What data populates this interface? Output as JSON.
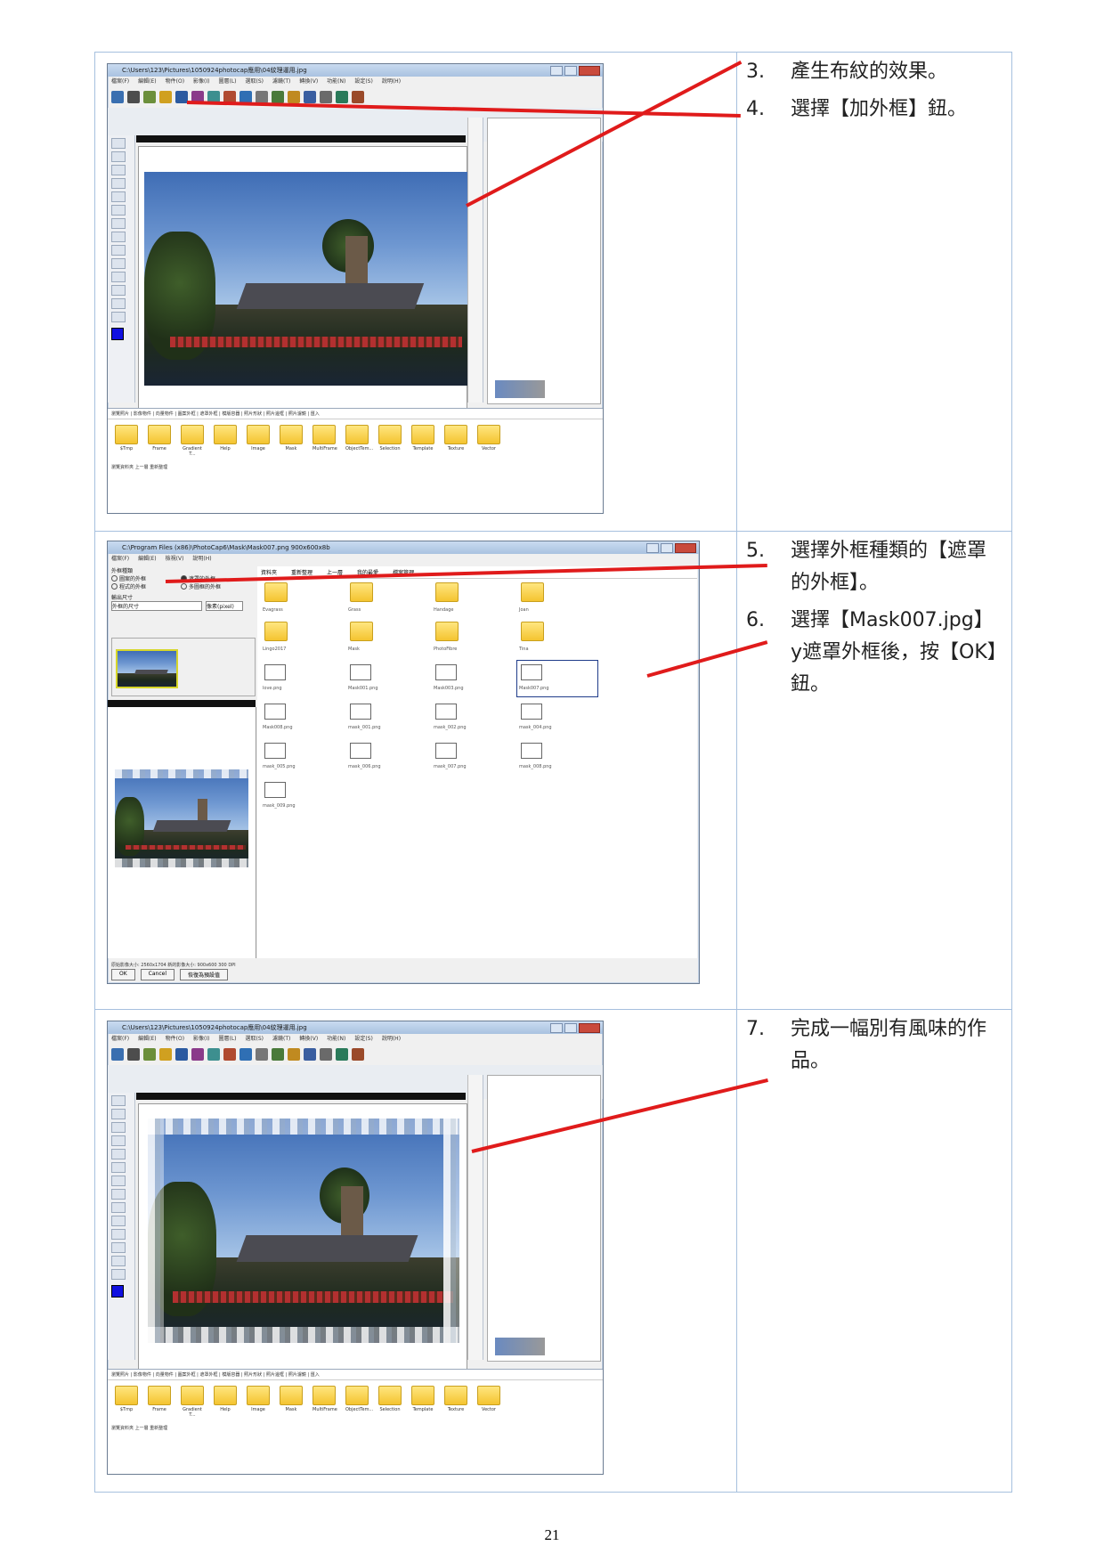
{
  "steps": [
    {
      "num": "3.",
      "text": "產生布紋的效果。"
    },
    {
      "num": "4.",
      "text": "選擇【加外框】鈕。"
    },
    {
      "num": "5.",
      "text": "選擇外框種類的【遮罩的外框】。"
    },
    {
      "num": "6.",
      "text": "選擇【Mask007.jpg】y遮罩外框後，按【OK】鈕。"
    },
    {
      "num": "7.",
      "text": "完成一幅別有風味的作品。"
    }
  ],
  "screenshot1": {
    "title": "C:\\Users\\123\\Pictures\\1050924photocap應用\\04紋理運用.jpg",
    "menu": [
      "檔案(F)",
      "編輯(E)",
      "物件(O)",
      "影像(I)",
      "圖層(L)",
      "選取(S)",
      "濾鏡(T)",
      "轉換(V)",
      "功能(N)",
      "設定(S)",
      "說明(H)"
    ],
    "tabs": "瀏覽照片 | 影像物件 | 向量物件 | 圖案外框 | 遮罩外框 | 模版容器 | 照片形狀 | 照片邊框 | 照片濾鏡 | 匯入",
    "folders": [
      "$Tmp",
      "Frame",
      "Gradient T...",
      "Help",
      "Image",
      "Mask",
      "MultiFrame",
      "ObjectTem...",
      "Selection",
      "Template",
      "Texture",
      "Vector"
    ],
    "status": "瀏覽資料夾   上一層   重新整理"
  },
  "screenshot2": {
    "title": "C:\\Program Files (x86)\\PhotoCap6\\Mask\\Mask007.png  900x600x8b",
    "menu": [
      "檔案(F)",
      "編輯(E)",
      "檢視(V)",
      "說明(H)"
    ],
    "frame_type_label": "外框種類",
    "options": [
      "圖案的外框",
      "遮罩的外框",
      "程式的外框",
      "多圖框的外框"
    ],
    "output_size": "輸出尺寸",
    "output_value": "外框的尺寸",
    "unit": "像素(pixel)",
    "nav": [
      "資料夾",
      "重新整理",
      "上一層",
      "我的最愛",
      "檔案管理"
    ],
    "files": [
      "Evagrass",
      "Grass",
      "Handage",
      "Joan",
      "Lingo2017",
      "Mask",
      "PhotoFibre",
      "Tina",
      "love.png",
      "Mask001.png",
      "Mask003.png",
      "Mask007.png",
      "Mask008.png",
      "mask_001.png",
      "mask_002.png",
      "mask_004.png",
      "mask_005.png",
      "mask_006.png",
      "mask_007.png",
      "mask_008.png",
      "mask_009.png"
    ],
    "status": "原始影像大小: 2560x1704  新的影像大小: 900x600 300 DPI",
    "buttons": [
      "OK",
      "Cancel",
      "恢復為預設值"
    ]
  },
  "screenshot3": {
    "title": "C:\\Users\\123\\Pictures\\1050924photocap應用\\04紋理運用.jpg",
    "menu": [
      "檔案(F)",
      "編輯(E)",
      "物件(O)",
      "影像(I)",
      "圖層(L)",
      "選取(S)",
      "濾鏡(T)",
      "轉換(V)",
      "功能(N)",
      "設定(S)",
      "說明(H)"
    ],
    "tabs": "瀏覽照片 | 影像物件 | 向量物件 | 圖案外框 | 遮罩外框 | 模版容器 | 照片形狀 | 照片邊框 | 照片濾鏡 | 匯入",
    "folders": [
      "$Tmp",
      "Frame",
      "Gradient T...",
      "Help",
      "Image",
      "Mask",
      "MultiFrame",
      "ObjectTem...",
      "Selection",
      "Template",
      "Texture",
      "Vector"
    ],
    "status": "瀏覽資料夾   上一層   重新整理"
  },
  "page_number": "21",
  "colors": {
    "annotation_line": "#e01b1b",
    "table_border": "#a6c0de"
  }
}
